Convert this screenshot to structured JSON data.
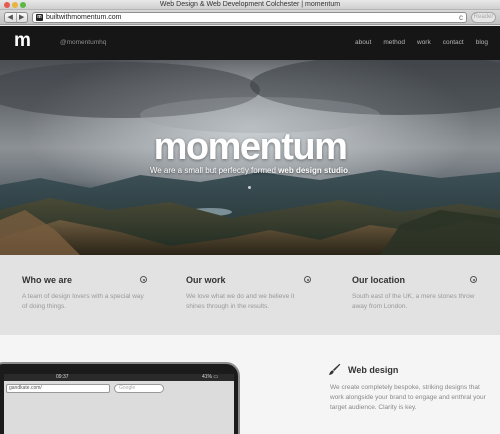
{
  "browser": {
    "window_title": "Web Design & Web Development Colchester | momentum",
    "url": "builtwithmomentum.com",
    "favicon_letter": "m",
    "reader_label": "Reader",
    "back_glyph": "◀",
    "forward_glyph": "▶",
    "reload_glyph": "c"
  },
  "nav": {
    "logo": "m",
    "handle": "@momentumhq",
    "links": [
      "about",
      "method",
      "work",
      "contact",
      "blog"
    ]
  },
  "hero": {
    "title": "momentum",
    "tagline_prefix": "We are a small but perfectly formed ",
    "tagline_bold": "web design studio",
    "tagline_suffix": "."
  },
  "info": {
    "columns": [
      {
        "title": "Who we are",
        "text": "A team of design lovers with a special way of doing things."
      },
      {
        "title": "Our work",
        "text": "We love what we do and we believe it shines through in the results."
      },
      {
        "title": "Our location",
        "text": "South east of the UK, a mere stones throw away from London."
      }
    ]
  },
  "device": {
    "time": "09:37",
    "battery": "41% ▭",
    "url": "gandkate.com/",
    "search_placeholder": "Google"
  },
  "service": {
    "icon": "paintbrush-icon",
    "title": "Web design",
    "text": "We create completely bespoke, striking designs that work alongside your brand to engage and enthral your target audience. Clarity is key."
  },
  "colors": {
    "nav_bg": "#161616",
    "info_bg": "#e2e2e2",
    "heading": "#333333",
    "body_text": "#999999"
  }
}
